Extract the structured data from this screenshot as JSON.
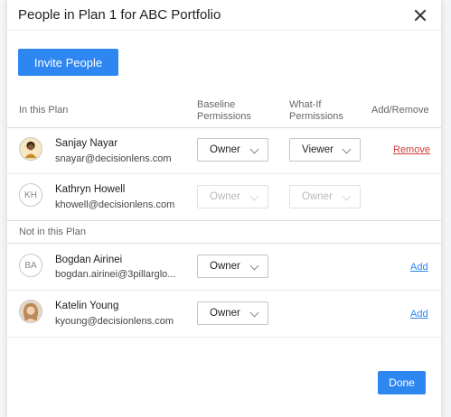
{
  "modal": {
    "title": "People in Plan 1 for ABC Portfolio",
    "invite_label": "Invite People",
    "done_label": "Done"
  },
  "columns": {
    "in_plan": "In this Plan",
    "baseline": "Baseline\nPermissions",
    "whatif": "What-If\nPermissions",
    "add_remove": "Add/Remove"
  },
  "in_plan": [
    {
      "name": "Sanjay Nayar",
      "email": "snayar@decisionlens.com",
      "initials": "",
      "avatar_icon": "avatar-photo-icon",
      "baseline": "Owner",
      "whatif": "Viewer",
      "action": "Remove",
      "disabled": false
    },
    {
      "name": "Kathryn Howell",
      "email": "khowell@decisionlens.com",
      "initials": "KH",
      "baseline": "Owner",
      "whatif": "Owner",
      "action": "",
      "disabled": true
    }
  ],
  "not_in_plan_label": "Not in this Plan",
  "not_in_plan": [
    {
      "name": "Bogdan Airinei",
      "email": "bogdan.airinei@3pillarglo...",
      "initials": "BA",
      "baseline": "Owner",
      "action": "Add"
    },
    {
      "name": "Katelin Young",
      "email": "kyoung@decisionlens.com",
      "initials": "",
      "avatar_icon": "avatar-photo-icon",
      "baseline": "Owner",
      "action": "Add"
    }
  ],
  "colors": {
    "accent": "#2e86f0",
    "danger": "#d23b3b"
  }
}
